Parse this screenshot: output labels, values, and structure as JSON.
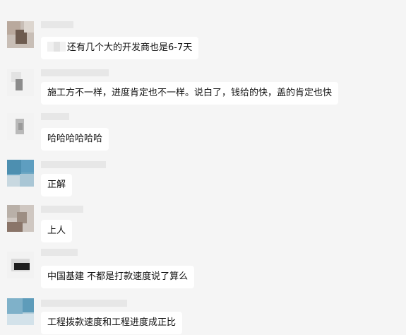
{
  "messages": [
    {
      "text": "还有几个大的开发商也是6-7天",
      "redacted_prefix": true
    },
    {
      "text": "施工方不一样，进度肯定也不一样。说白了，钱给的快，盖的肯定也快"
    },
    {
      "text": "哈哈哈哈哈哈"
    },
    {
      "text": "正解"
    },
    {
      "text": "上人"
    },
    {
      "text": "中国基建 不都是打款速度说了算么"
    },
    {
      "text": "工程拨款速度和工程进度成正比"
    }
  ],
  "colors": {
    "background": "#f5f5f5",
    "bubble": "#ffffff",
    "text": "#111111"
  }
}
